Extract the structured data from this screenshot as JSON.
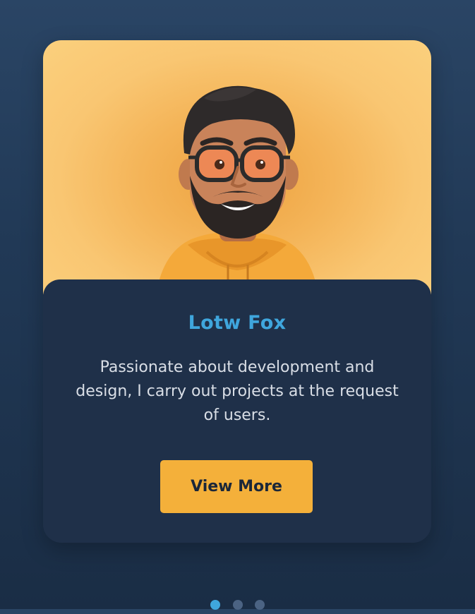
{
  "profile_card": {
    "name": "Lotw Fox",
    "bio": "Passionate about development and design, I carry out projects at the request of users.",
    "button_label": "View More"
  },
  "carousel": {
    "total_slides": 3,
    "active_slide": 1
  },
  "colors": {
    "background": "#243d5b",
    "card_background": "#1f3049",
    "hero_background": "#f6bb5f",
    "name_color": "#3fa6dd",
    "button_color": "#f4b03a",
    "active_dot": "#3fa6dd",
    "inactive_dot": "#4b6383"
  },
  "icons": {
    "avatar": "bearded-man-with-glasses-avatar"
  }
}
